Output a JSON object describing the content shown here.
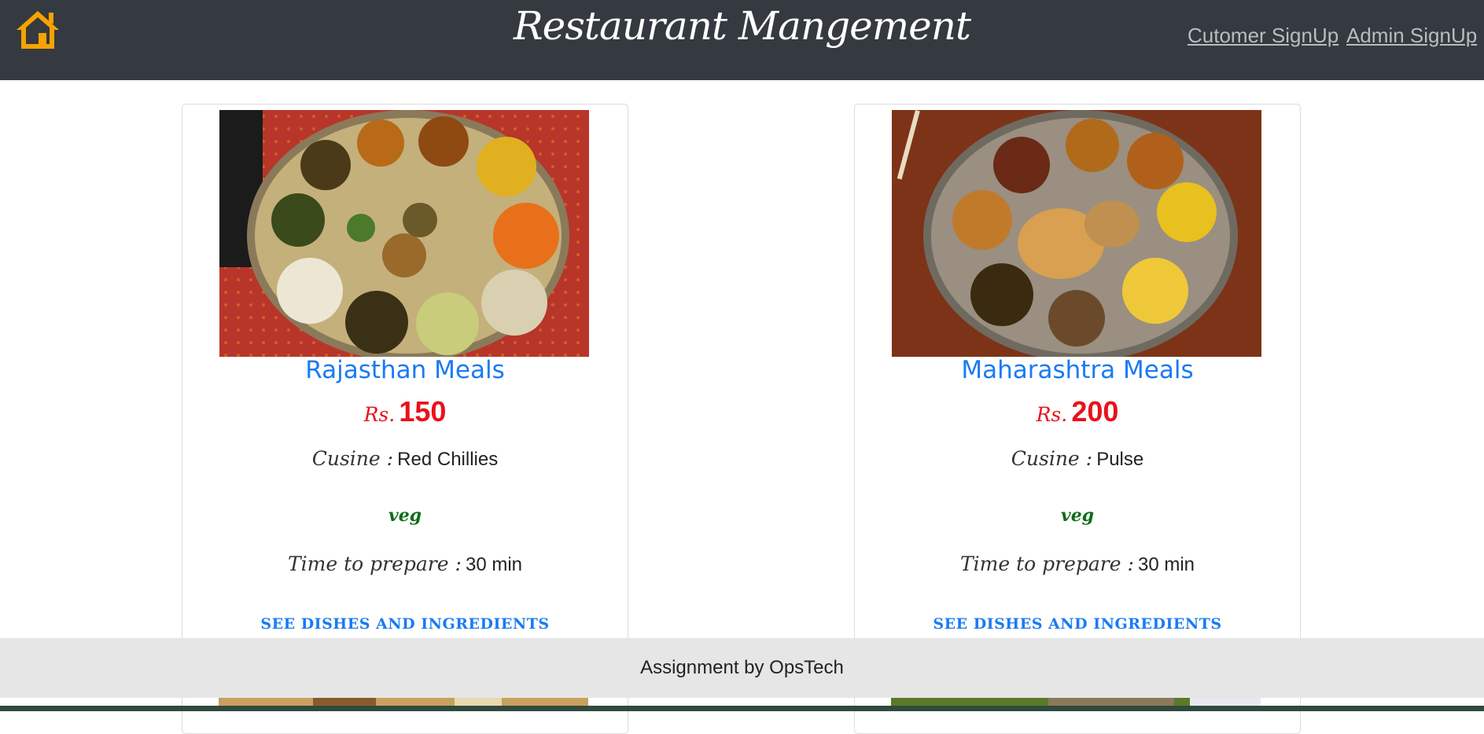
{
  "navbar": {
    "brand": "Restaurant Mangement",
    "links": {
      "customer_signup": "Cutomer SignUp",
      "admin_signup": "Admin SignUp"
    }
  },
  "colors": {
    "navbar_bg": "#343a40",
    "accent": "#1a7bf2",
    "price": "#e8121c",
    "veg": "#0d6e1a",
    "home_icon": "#f7a200"
  },
  "cards": [
    {
      "title": "Rajasthan Meals",
      "price_label": "Rs.",
      "price": "150",
      "cuisine_label": "Cusine :",
      "cuisine": "Red Chillies",
      "type": "veg",
      "time_label": "Time to prepare :",
      "time": "30 min",
      "link": "SEE DISHES AND INGREDIENTS"
    },
    {
      "title": "Maharashtra Meals",
      "price_label": "Rs.",
      "price": "200",
      "cuisine_label": "Cusine :",
      "cuisine": "Pulse",
      "type": "veg",
      "time_label": "Time to prepare :",
      "time": "30 min",
      "link": "SEE DISHES AND INGREDIENTS"
    }
  ],
  "footer": {
    "text": "Assignment by OpsTech"
  }
}
